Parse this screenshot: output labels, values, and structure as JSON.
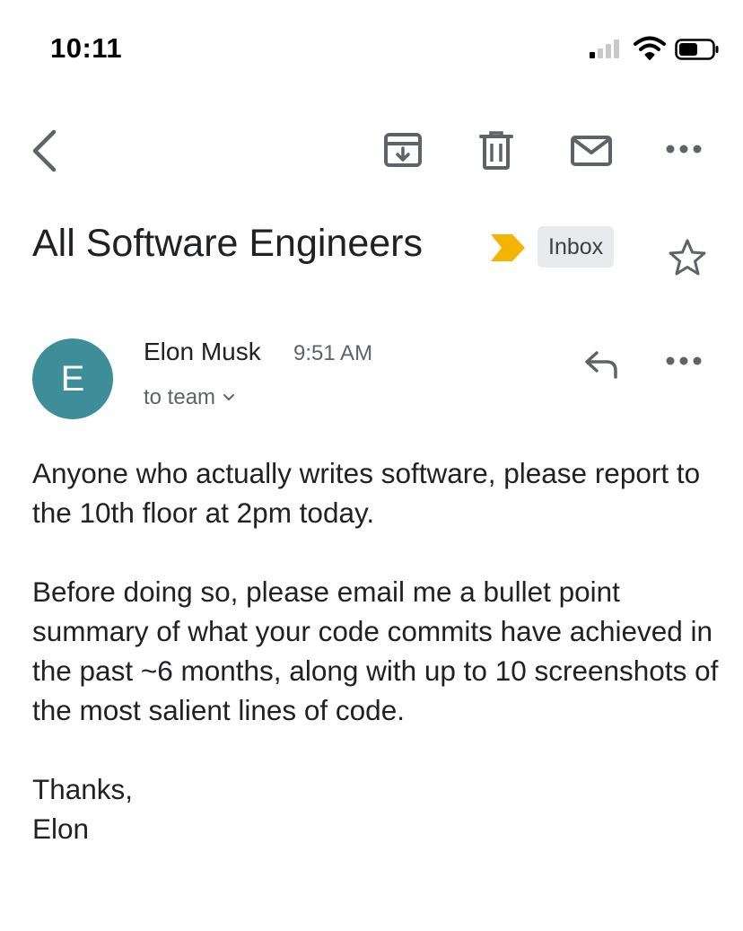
{
  "status_bar": {
    "time": "10:11",
    "signal_icon": "cellular-signal-icon",
    "wifi_icon": "wifi-icon",
    "battery_icon": "battery-icon"
  },
  "toolbar": {
    "back_icon": "back-chevron-icon",
    "archive_icon": "archive-icon",
    "delete_icon": "trash-icon",
    "mark_unread_icon": "mail-icon",
    "more_icon": "more-horizontal-icon"
  },
  "email": {
    "subject": "All Software Engineers",
    "importance_marker_color": "#f4b400",
    "label": "Inbox",
    "sender": {
      "initial": "E",
      "avatar_color": "#3e8e9a",
      "name": "Elon Musk",
      "time": "9:51 AM",
      "recipients": "to team"
    },
    "body": {
      "paragraph_1": "Anyone who actually writes software, please report to the 10th floor at 2pm today.",
      "paragraph_2": "Before doing so, please email me a bullet point summary of what your code commits have achieved in the past ~6 months, along with up to 10 screenshots of the most salient lines of code.",
      "closing": "Thanks,",
      "signature": "Elon"
    }
  }
}
